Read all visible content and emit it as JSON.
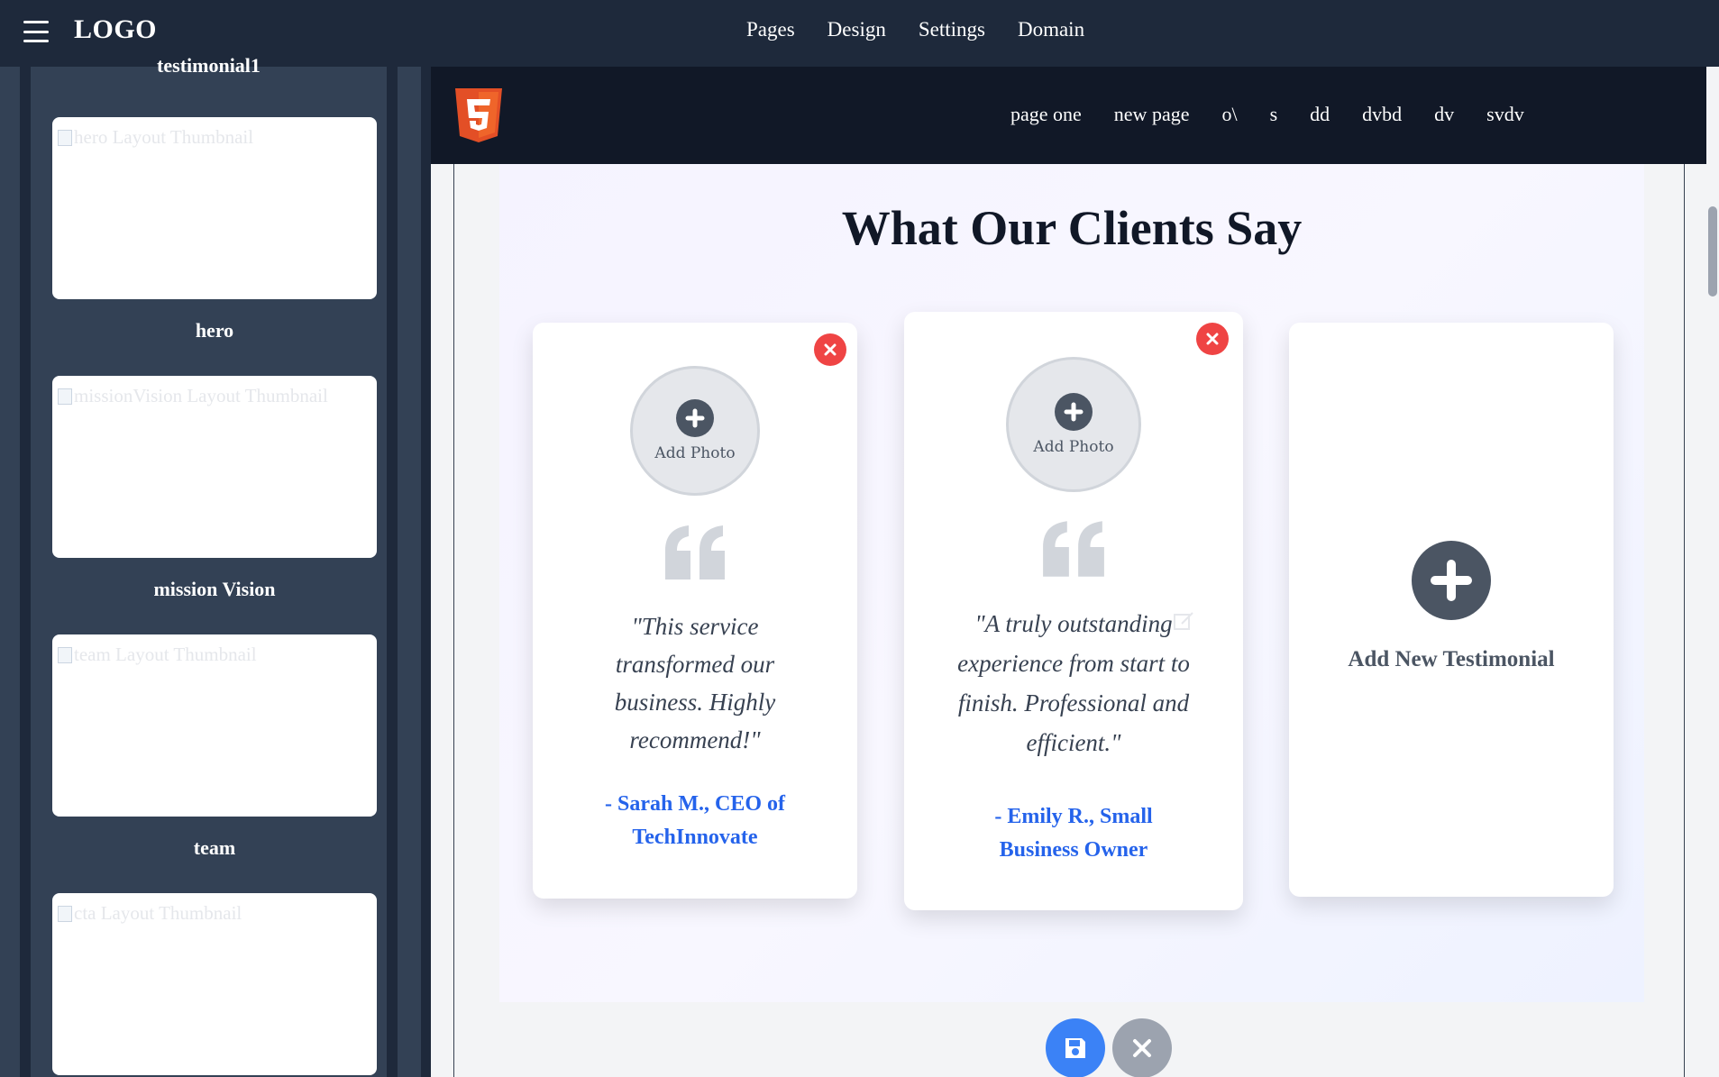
{
  "topbar": {
    "logo": "LOGO",
    "nav": [
      "Pages",
      "Design",
      "Settings",
      "Domain"
    ]
  },
  "sidebar": {
    "partial_label": "testimonial1",
    "layouts": [
      {
        "thumb_alt": "hero Layout Thumbnail",
        "label": "hero"
      },
      {
        "thumb_alt": "missionVision Layout Thumbnail",
        "label": "mission Vision"
      },
      {
        "thumb_alt": "team Layout Thumbnail",
        "label": "team"
      },
      {
        "thumb_alt": "cta Layout Thumbnail",
        "label": ""
      }
    ]
  },
  "site": {
    "nav": [
      "page one",
      "new page",
      "o\\",
      "s",
      "dd",
      "dvbd",
      "dv",
      "svdv"
    ]
  },
  "testimonials": {
    "title": "What Our Clients Say",
    "add_photo_label": "Add Photo",
    "cards": [
      {
        "quote": "\"This service transformed our business. Highly recommend!\"",
        "author": "- Sarah M., CEO of TechInnovate"
      },
      {
        "quote": "\"A truly outstanding experience from start to finish. Professional and efficient.\"",
        "author": "- Emily R., Small Business Owner"
      }
    ],
    "add_new_label": "Add New Testimonial"
  },
  "colors": {
    "topbar": "#1e293b",
    "sidebar": "#334155",
    "accent": "#2563eb",
    "danger": "#ef4444",
    "cancel": "#9ca3af"
  }
}
